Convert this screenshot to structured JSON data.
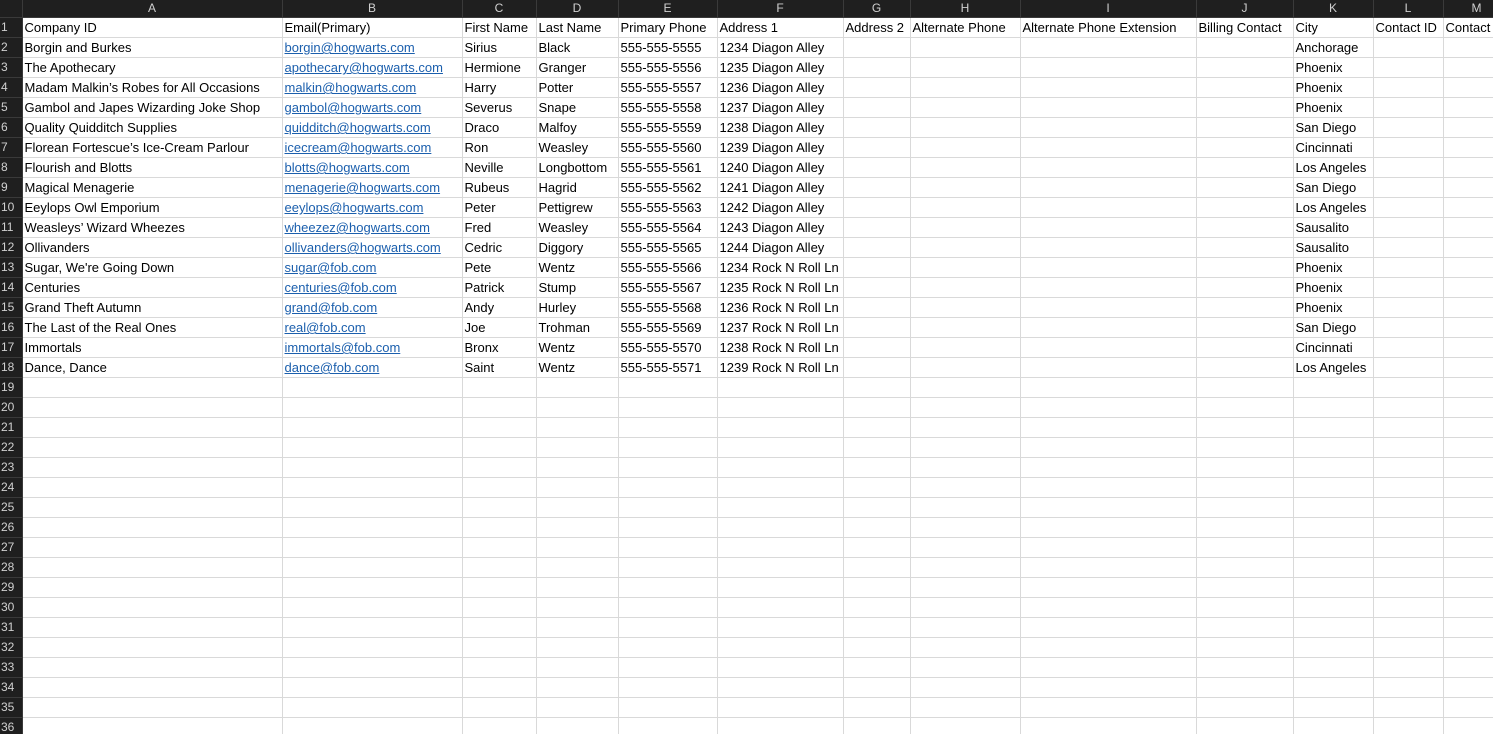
{
  "columns": [
    "A",
    "B",
    "C",
    "D",
    "E",
    "F",
    "G",
    "H",
    "I",
    "J",
    "K",
    "L",
    "M"
  ],
  "header_row": [
    "Company ID",
    "Email(Primary)",
    "First Name",
    "Last Name",
    "Primary Phone",
    "Address 1",
    "Address 2",
    "Alternate Phone",
    "Alternate Phone Extension",
    "Billing Contact",
    "City",
    "Contact ID",
    "Contact"
  ],
  "rows": [
    [
      "Borgin and Burkes",
      "borgin@hogwarts.com",
      "Sirius",
      "Black",
      "555-555-5555",
      "1234 Diagon Alley",
      "",
      "",
      "",
      "",
      "Anchorage",
      "",
      ""
    ],
    [
      "The Apothecary",
      "apothecary@hogwarts.com",
      "Hermione",
      "Granger",
      "555-555-5556",
      "1235 Diagon Alley",
      "",
      "",
      "",
      "",
      "Phoenix",
      "",
      ""
    ],
    [
      "Madam Malkin’s Robes for All Occasions",
      "malkin@hogwarts.com",
      "Harry",
      "Potter",
      "555-555-5557",
      "1236 Diagon Alley",
      "",
      "",
      "",
      "",
      "Phoenix",
      "",
      ""
    ],
    [
      "Gambol and Japes Wizarding Joke Shop",
      "gambol@hogwarts.com",
      "Severus",
      "Snape",
      "555-555-5558",
      "1237 Diagon Alley",
      "",
      "",
      "",
      "",
      "Phoenix",
      "",
      ""
    ],
    [
      "Quality Quidditch Supplies",
      "quidditch@hogwarts.com",
      "Draco",
      "Malfoy",
      "555-555-5559",
      "1238 Diagon Alley",
      "",
      "",
      "",
      "",
      "San Diego",
      "",
      ""
    ],
    [
      "Florean Fortescue’s Ice-Cream Parlour",
      "icecream@hogwarts.com",
      "Ron",
      "Weasley",
      "555-555-5560",
      "1239 Diagon Alley",
      "",
      "",
      "",
      "",
      "Cincinnati",
      "",
      ""
    ],
    [
      "Flourish and Blotts",
      "blotts@hogwarts.com",
      "Neville",
      "Longbottom",
      "555-555-5561",
      "1240 Diagon Alley",
      "",
      "",
      "",
      "",
      "Los Angeles",
      "",
      ""
    ],
    [
      "Magical Menagerie",
      "menagerie@hogwarts.com",
      "Rubeus",
      "Hagrid",
      "555-555-5562",
      "1241 Diagon Alley",
      "",
      "",
      "",
      "",
      "San Diego",
      "",
      ""
    ],
    [
      "Eeylops Owl Emporium",
      "eeylops@hogwarts.com",
      "Peter",
      "Pettigrew",
      "555-555-5563",
      "1242 Diagon Alley",
      "",
      "",
      "",
      "",
      "Los Angeles",
      "",
      ""
    ],
    [
      "Weasleys’ Wizard Wheezes",
      "wheezez@hogwarts.com",
      "Fred",
      "Weasley",
      "555-555-5564",
      "1243 Diagon Alley",
      "",
      "",
      "",
      "",
      "Sausalito",
      "",
      ""
    ],
    [
      "Ollivanders",
      "ollivanders@hogwarts.com",
      "Cedric",
      "Diggory",
      "555-555-5565",
      "1244 Diagon Alley",
      "",
      "",
      "",
      "",
      "Sausalito",
      "",
      ""
    ],
    [
      "Sugar, We're Going Down",
      "sugar@fob.com",
      "Pete",
      "Wentz",
      "555-555-5566",
      "1234 Rock N Roll Ln",
      "",
      "",
      "",
      "",
      "Phoenix",
      "",
      ""
    ],
    [
      "Centuries",
      "centuries@fob.com",
      "Patrick",
      "Stump",
      "555-555-5567",
      "1235 Rock N Roll Ln",
      "",
      "",
      "",
      "",
      "Phoenix",
      "",
      ""
    ],
    [
      "Grand Theft Autumn",
      "grand@fob.com",
      "Andy",
      "Hurley",
      "555-555-5568",
      "1236 Rock N Roll Ln",
      "",
      "",
      "",
      "",
      "Phoenix",
      "",
      ""
    ],
    [
      "The Last of the Real Ones",
      "real@fob.com",
      "Joe",
      "Trohman",
      "555-555-5569",
      "1237 Rock N Roll Ln",
      "",
      "",
      "",
      "",
      "San Diego",
      "",
      ""
    ],
    [
      "Immortals",
      "immortals@fob.com",
      "Bronx",
      "Wentz",
      "555-555-5570",
      "1238 Rock N Roll Ln",
      "",
      "",
      "",
      "",
      "Cincinnati",
      "",
      ""
    ],
    [
      "Dance, Dance",
      "dance@fob.com",
      "Saint",
      "Wentz",
      "555-555-5571",
      "1239 Rock N Roll Ln",
      "",
      "",
      "",
      "",
      "Los Angeles",
      "",
      ""
    ]
  ],
  "row_numbers": [
    "1",
    "2",
    "3",
    "4",
    "5",
    "6",
    "7",
    "8",
    "9",
    "10",
    "11",
    "12",
    "13",
    "14",
    "15",
    "16",
    "17",
    "18",
    "19",
    "20",
    "21",
    "22",
    "23",
    "24",
    "25",
    "26",
    "27",
    "28",
    "29",
    "30",
    "31",
    "32",
    "33",
    "34",
    "35",
    "36"
  ],
  "colors": {
    "header_bg": "#1f1f1f",
    "header_text": "#d0d0d0",
    "gridline": "#d9d9d9",
    "link": "#1b5fad"
  }
}
